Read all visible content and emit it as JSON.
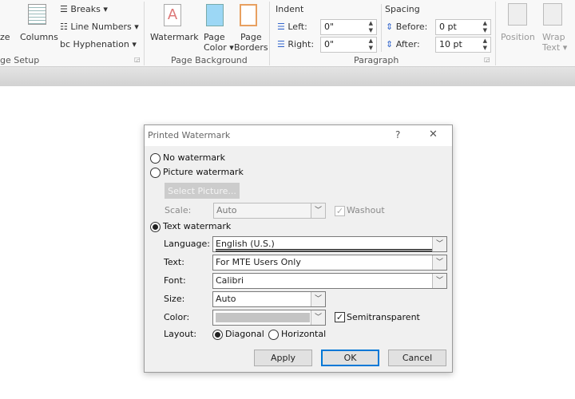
{
  "ribbon": {
    "page_setup": {
      "size_partial": "ze",
      "columns": "Columns",
      "breaks": "Breaks",
      "line_numbers": "Line Numbers",
      "hyphenation": "Hyphenation",
      "group_label": "ge Setup"
    },
    "page_background": {
      "watermark": "Watermark",
      "page_color_1": "Page",
      "page_color_2": "Color",
      "page_borders_1": "Page",
      "page_borders_2": "Borders",
      "group_label": "Page Background"
    },
    "paragraph": {
      "indent_title": "Indent",
      "left_label": "Left:",
      "left_value": "0\"",
      "right_label": "Right:",
      "right_value": "0\"",
      "spacing_title": "Spacing",
      "before_label": "Before:",
      "before_value": "0 pt",
      "after_label": "After:",
      "after_value": "10 pt",
      "group_label": "Paragraph"
    },
    "arrange": {
      "position": "Position",
      "wrap_1": "Wrap",
      "wrap_2": "Text"
    }
  },
  "dialog": {
    "title": "Printed Watermark",
    "help": "?",
    "close": "✕",
    "no_watermark": "No watermark",
    "picture_watermark": "Picture watermark",
    "select_picture": "Select Picture...",
    "scale_label": "Scale:",
    "scale_value": "Auto",
    "washout": "Washout",
    "text_watermark": "Text watermark",
    "language_label": "Language:",
    "language_value": "English (U.S.)",
    "text_label": "Text:",
    "text_value": "For MTE Users Only",
    "font_label": "Font:",
    "font_value": "Calibri",
    "size_label": "Size:",
    "size_value": "Auto",
    "color_label": "Color:",
    "color_value": "#c4c4c4",
    "semitransparent": "Semitransparent",
    "layout_label": "Layout:",
    "diagonal": "Diagonal",
    "horizontal": "Horizontal",
    "selected_watermark": "text",
    "selected_layout": "diagonal",
    "washout_checked": true,
    "semitransparent_checked": true,
    "apply": "Apply",
    "ok": "OK",
    "cancel": "Cancel",
    "accent": "#0078d7"
  }
}
